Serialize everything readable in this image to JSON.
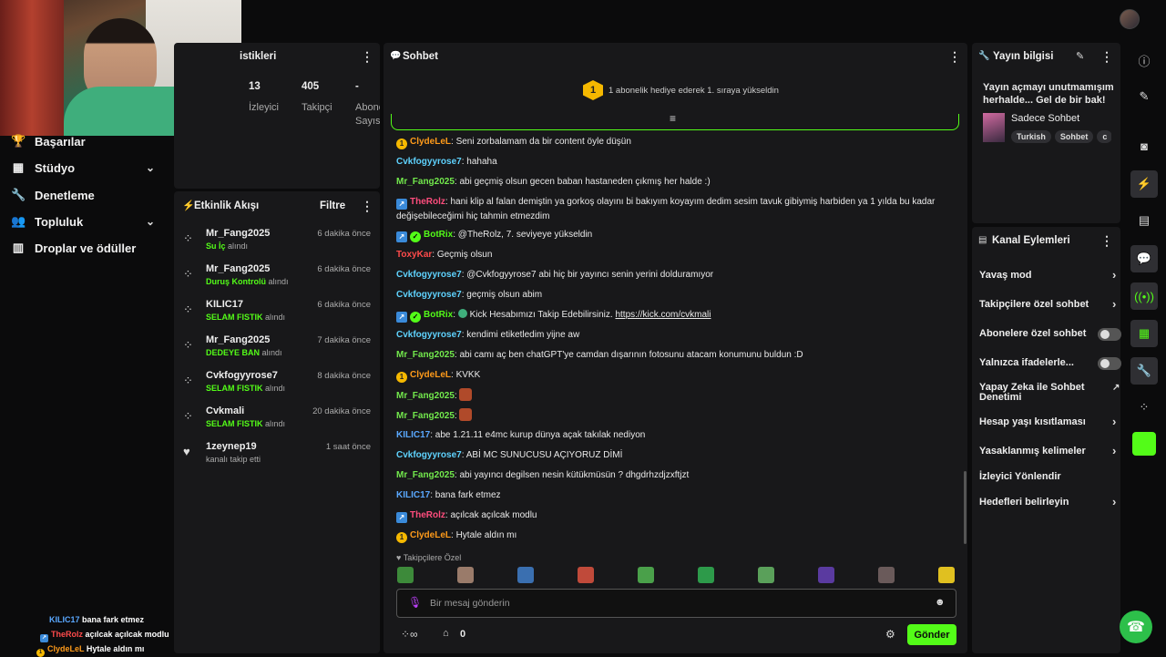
{
  "stats": {
    "title_partial": "istikleri",
    "viewers": {
      "value": "13",
      "label": "İzleyici"
    },
    "followers": {
      "value": "405",
      "label": "Takipçi"
    },
    "subs": {
      "value": "-",
      "label": "Abone",
      "label2": "Sayısı"
    }
  },
  "nav": [
    {
      "label": "Başarılar",
      "icon": "trophy-icon"
    },
    {
      "label": "Stüdyo",
      "icon": "studio-icon",
      "expand": true
    },
    {
      "label": "Denetleme",
      "icon": "wrench-icon"
    },
    {
      "label": "Topluluk",
      "icon": "community-icon",
      "expand": true
    },
    {
      "label": "Droplar ve ödüller",
      "icon": "drops-icon"
    }
  ],
  "activity": {
    "title": "Etkinlik Akışı",
    "filter": "Filtre",
    "received": "alındı",
    "events": [
      {
        "user": "Mr_Fang2025",
        "time": "6 dakika önce",
        "reward": "Su İç"
      },
      {
        "user": "Mr_Fang2025",
        "time": "6 dakika önce",
        "reward": "Duruş Kontrolü"
      },
      {
        "user": "KILIC17",
        "time": "6 dakika önce",
        "reward": "SELAM FISTIK"
      },
      {
        "user": "Mr_Fang2025",
        "time": "7 dakika önce",
        "reward": "DEDEYE BAN"
      },
      {
        "user": "Cvkfogyyrose7",
        "time": "8 dakika önce",
        "reward": "SELAM FISTIK"
      },
      {
        "user": "Cvkmali",
        "time": "20 dakika önce",
        "reward": "SELAM FISTIK"
      },
      {
        "user": "1zeynep19",
        "time": "1 saat önce",
        "text": "kanalı takip etti"
      }
    ]
  },
  "chat": {
    "title": "Sohbet",
    "pinned": "1 abonelik hediye ederek 1. sıraya yükseldin",
    "followers_only": "Takipçilere Özel",
    "placeholder": "Bir mesaj gönderin",
    "send": "Gönder",
    "points": "0",
    "messages": [
      {
        "user": "ClydeLeL",
        "text": "Seni zorbalamam da bir content öyle düşün"
      },
      {
        "user": "Cvkfogyyrose7",
        "text": "hahaha"
      },
      {
        "user": "Mr_Fang2025",
        "text": "abi geçmiş olsun gecen baban hastaneden çıkmış her halde :)"
      },
      {
        "user": "TheRolz",
        "text": "hani klip al falan demiştin ya gorkoş olayını bi bakıyım koyayım dedim sesim tavuk gibiymiş harbiden ya 1 yılda bu kadar",
        "text2": "değişebileceğimi hiç tahmin etmezdim"
      },
      {
        "user": "BotRix",
        "text": "@TheRolz, 7. seviyeye yükseldin"
      },
      {
        "user": "ToxyKar",
        "text": "Geçmiş olsun"
      },
      {
        "user": "Cvkfogyyrose7",
        "text": "@Cvkfogyyrose7 abi hiç bir yayıncı senin yerini dolduramıyor"
      },
      {
        "user": "Cvkfogyyrose7",
        "text": "geçmiş olsun abim"
      },
      {
        "user": "BotRix",
        "text": "Kick Hesabımızı Takip Edebilirsiniz.",
        "link": "https://kick.com/cvkmali"
      },
      {
        "user": "Cvkfogyyrose7",
        "text": "kendimi etiketledim yijne aw"
      },
      {
        "user": "Mr_Fang2025",
        "text": "abi camı aç ben chatGPT'ye camdan dışarının fotosunu atacam konumunu buldun :D"
      },
      {
        "user": "ClydeLeL",
        "text": "KVKK"
      },
      {
        "user": "Mr_Fang2025",
        "text": ""
      },
      {
        "user": "Mr_Fang2025",
        "text": ""
      },
      {
        "user": "KILIC17",
        "text": "abe 1.21.11 e4mc kurup dünya açak takılak nediyon"
      },
      {
        "user": "Cvkfogyyrose7",
        "text": "ABİ MC SUNUCUSU AÇIYORUZ DİMİ"
      },
      {
        "user": "Mr_Fang2025",
        "text": "abi yayıncı degilsen nesin kütükmüsün ? dhgdrhzdjzxftjzt"
      },
      {
        "user": "KILIC17",
        "text": "bana fark etmez"
      },
      {
        "user": "TheRolz",
        "text": "açılcak açılcak modlu"
      },
      {
        "user": "ClydeLeL",
        "text": "Hytale aldın mı"
      }
    ]
  },
  "stream_info": {
    "title": "Yayın bilgisi",
    "stream_title": "Yayın açmayı unutmamışım herhalde... Gel de bir bak!",
    "category": "Sadece Sohbet",
    "tags": [
      "Turkish",
      "Sohbet",
      "c"
    ]
  },
  "channel_actions": {
    "title": "Kanal Eylemleri",
    "items": [
      {
        "label": "Yavaş mod",
        "type": "chev"
      },
      {
        "label": "Takipçilere özel sohbet",
        "type": "chev"
      },
      {
        "label": "Abonelere özel sohbet",
        "type": "toggle"
      },
      {
        "label": "Yalnızca ifadelerle...",
        "type": "toggle"
      },
      {
        "label": "Yapay Zeka ile Sohbet Denetimi",
        "type": "ext"
      },
      {
        "label": "Hesap yaşı kısıtlaması",
        "type": "chev"
      },
      {
        "label": "Yasaklanmış kelimeler",
        "type": "chev"
      },
      {
        "label": "İzleyici Yönlendir",
        "type": "none"
      },
      {
        "label": "Hedefleri belirleyin",
        "type": "chev"
      }
    ]
  },
  "overlay": [
    {
      "user": "KILIC17",
      "text": "bana fark etmez"
    },
    {
      "user": "TheRolz",
      "text": "açılcak açılcak modlu"
    },
    {
      "user": "ClydeLeL",
      "text": "Hytale aldın mı"
    }
  ],
  "colors": {
    "accent": "#53fc18",
    "panel": "#18181a",
    "bg": "#0b0b0c"
  }
}
